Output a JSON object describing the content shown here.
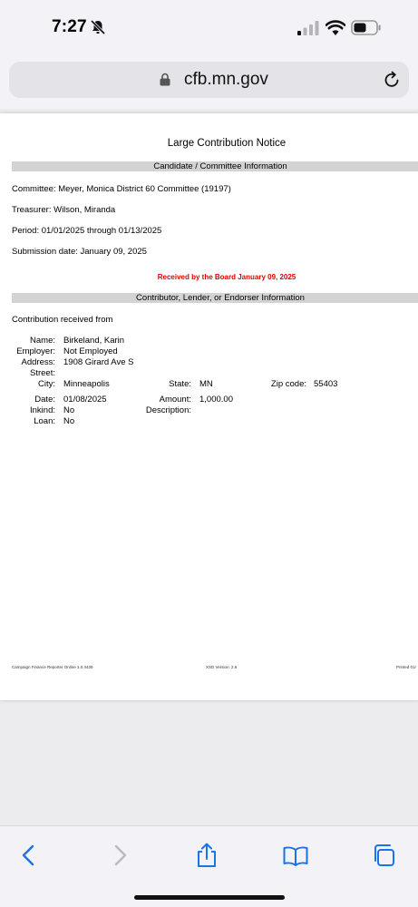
{
  "status_bar": {
    "time": "7:27"
  },
  "address_bar": {
    "url": "cfb.mn.gov"
  },
  "document": {
    "title": "Large Contribution Notice",
    "section1_header": "Candidate / Committee Information",
    "committee": "Committee: Meyer, Monica District 60 Committee (19197)",
    "treasurer": "Treasurer: Wilson, Miranda",
    "period": "Period: 01/01/2025 through 01/13/2025",
    "submission_date": "Submission date: January 09, 2025",
    "received_notice": "Received by the Board January 09, 2025",
    "section2_header": "Contributor, Lender, or Endorser Information",
    "contribution_intro": "Contribution received from",
    "labels": {
      "name": "Name:",
      "employer": "Employer:",
      "address": "Address:",
      "street": "Street:",
      "city": "City:",
      "state": "State:",
      "zip": "Zip code:",
      "date": "Date:",
      "amount": "Amount:",
      "inkind": "Inkind:",
      "description": "Description:",
      "loan": "Loan:"
    },
    "contributor": {
      "name": "Birkeland, Karin",
      "employer": "Not Employed",
      "address": "1908 Girard Ave S",
      "street": "",
      "city": "Minneapolis",
      "state": "MN",
      "zip": "55403",
      "date": "01/08/2025",
      "amount": "1,000.00",
      "inkind": "No",
      "description": "",
      "loan": "No"
    },
    "footer": {
      "left": "Campaign Finance Reporter Online 1.0.4439",
      "center": "XSD Version: 2.6",
      "right": "Printed 01/"
    }
  },
  "icons": {
    "bell": "bell-slash-icon",
    "signal": "cellular-signal-icon",
    "wifi": "wifi-icon",
    "battery": "battery-icon",
    "lock": "lock-icon",
    "reload": "reload-icon",
    "back": "back-chevron-icon",
    "forward": "forward-chevron-icon",
    "share": "share-icon",
    "bookmarks": "bookmarks-icon",
    "tabs": "tabs-icon"
  },
  "colors": {
    "accent": "#1a73e8",
    "received_red": "#e00000",
    "band_gray": "#d3d3d3"
  }
}
